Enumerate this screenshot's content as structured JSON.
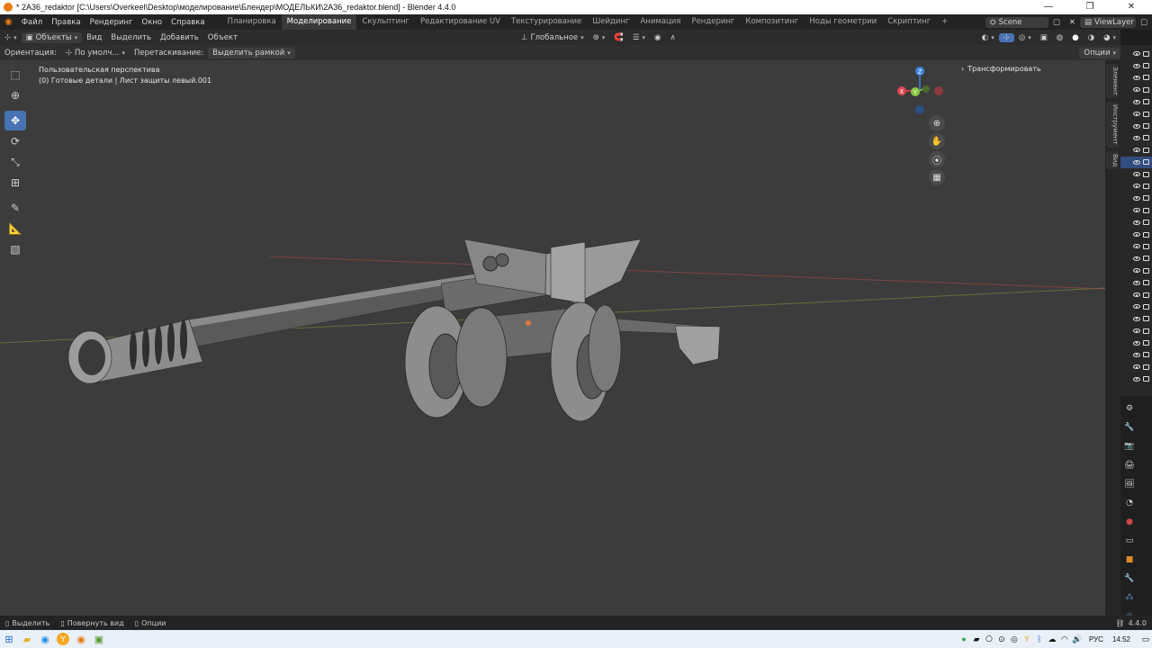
{
  "titlebar": {
    "title": "* 2A36_redaktor [C:\\Users\\Overkeel\\Desktop\\моделирование\\Блендер\\МОДЕЛЬКИ\\2A36_redaktor.blend] - Blender 4.4.0",
    "minimize": "—",
    "maximize": "❐",
    "close": "✕"
  },
  "topbar": {
    "menus": [
      "Файл",
      "Правка",
      "Рендеринг",
      "Окно",
      "Справка"
    ],
    "workspaces": [
      "Планировка",
      "Моделирование",
      "Скульптинг",
      "Редактирование UV",
      "Текстурирование",
      "Шейдинг",
      "Анимация",
      "Рендеринг",
      "Композитинг",
      "Ноды геометрии",
      "Скриптинг"
    ],
    "active_workspace": "Моделирование",
    "add_workspace": "+",
    "scene_label": "Scene",
    "viewlayer_label": "ViewLayer"
  },
  "header1": {
    "mode": "Объекты",
    "menus": [
      "Вид",
      "Выделить",
      "Добавить",
      "Объект"
    ],
    "transform_orientation": "Глобальное"
  },
  "header2": {
    "orientation_label": "Ориентация:",
    "orientation_value": "По умолч...",
    "drag_label": "Перетаскивание:",
    "drag_value": "Выделить рамкой",
    "options_label": "Опции"
  },
  "viewport": {
    "view_name": "Пользовательская перспектива",
    "object_info": "(0) Готовые детали | Лист защиты левый.001",
    "transform_panel": "Трансформировать",
    "gizmo": {
      "x": "X",
      "y": "Y",
      "z": "Z"
    }
  },
  "sidebar_tabs": [
    "Элемент",
    "Инструмент",
    "Вид"
  ],
  "statusbar": {
    "select": "Выделить",
    "rotate_view": "Повернуть вид",
    "options": "Опции",
    "version": "4.4.0"
  },
  "taskbar": {
    "language": "РУС",
    "time": "14:52"
  },
  "colors": {
    "accent": "#4772b3",
    "axis_x": "#e0434c",
    "axis_y": "#8bc53f",
    "axis_z": "#3d85e0",
    "viewport_bg": "#3c3c3c"
  }
}
